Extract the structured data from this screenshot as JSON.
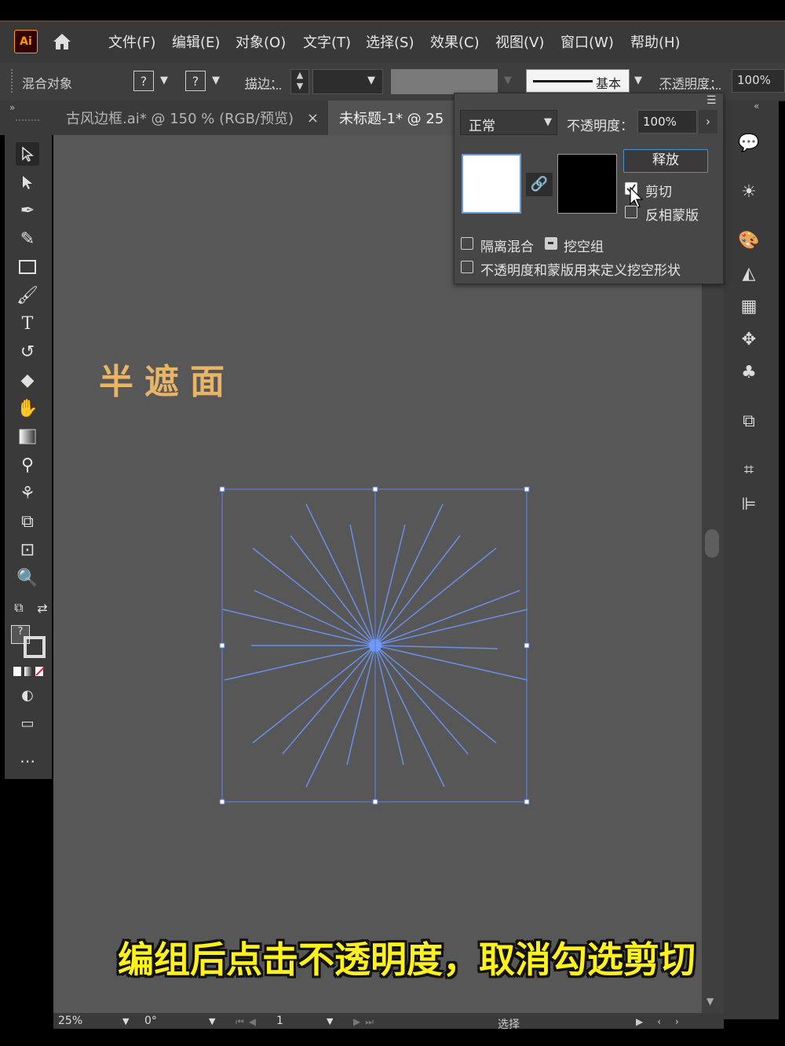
{
  "menubar": {
    "logo": "Ai",
    "items": [
      "文件(F)",
      "编辑(E)",
      "对象(O)",
      "文字(T)",
      "选择(S)",
      "效果(C)",
      "视图(V)",
      "窗口(W)",
      "帮助(H)"
    ]
  },
  "controlbar": {
    "object_type": "混合对象",
    "q1": "?",
    "q2": "?",
    "stroke_label": "描边：",
    "brush_label": "基本",
    "opacity_label": "不透明度：",
    "opacity_value": "100%"
  },
  "tabs": [
    {
      "label": "古风边框.ai* @ 150 % (RGB/预览)",
      "close": "×"
    },
    {
      "label": "未标题-1* @ 25"
    }
  ],
  "transparency_panel": {
    "blend_mode": "正常",
    "opacity_label": "不透明度：",
    "opacity_value": "100%",
    "release_button": "释放",
    "clip_label": "剪切",
    "invert_mask_label": "反相蒙版",
    "isolate_blend_label": "隔离混合",
    "knockout_group_label": "挖空组",
    "define_knockout_label": "不透明度和蒙版用来定义挖空形状"
  },
  "canvas": {
    "title_art": "半遮面"
  },
  "subtitle": "编组后点击不透明度，取消勾选剪切",
  "statusbar": {
    "zoom": "25%",
    "rotate": "0°",
    "artboard": "1",
    "mode": "选择"
  }
}
